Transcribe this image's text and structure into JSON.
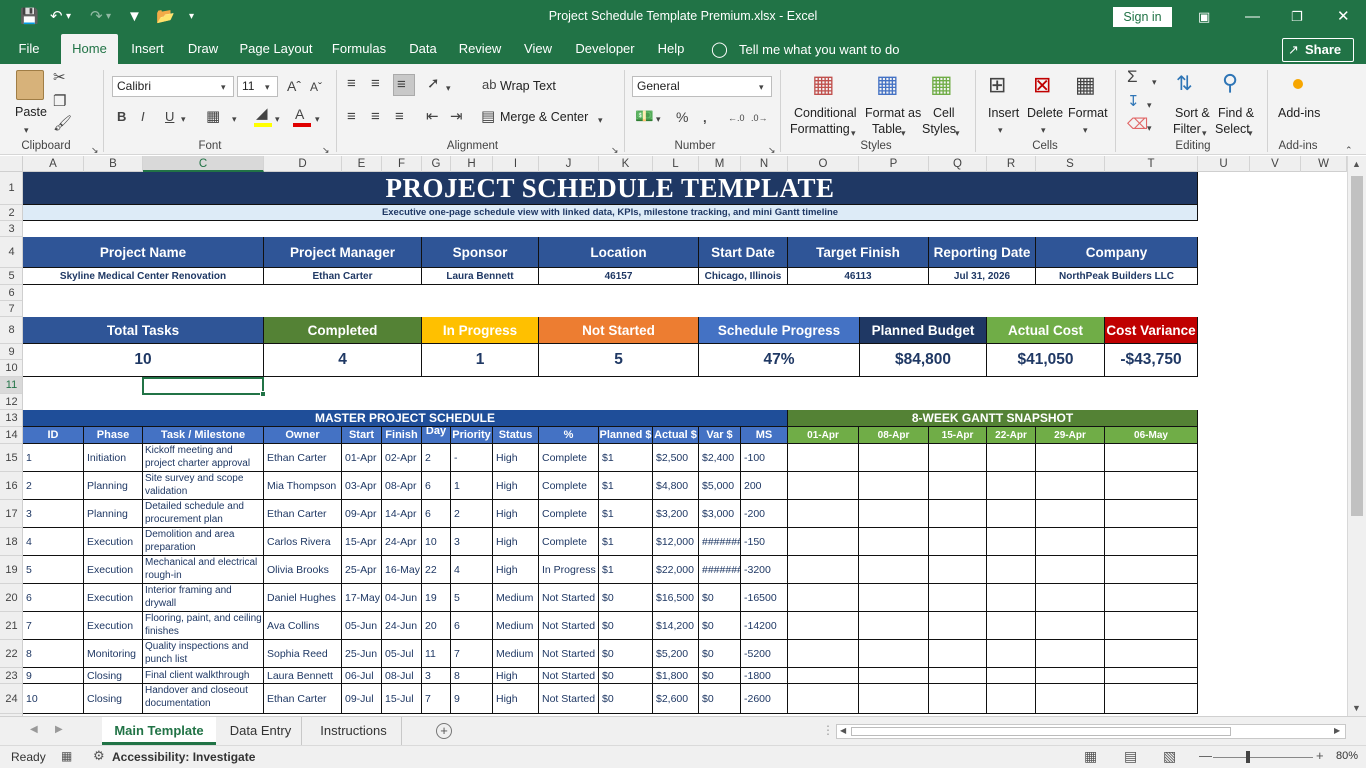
{
  "app": {
    "window_title": "Project Schedule Template Premium.xlsx  -  Excel",
    "sign_in": "Sign in",
    "share": "Share"
  },
  "ribbon_tabs": [
    "File",
    "Home",
    "Insert",
    "Draw",
    "Page Layout",
    "Formulas",
    "Data",
    "Review",
    "View",
    "Developer",
    "Help"
  ],
  "tell_me": "Tell me what you want to do",
  "ribbon": {
    "clipboard": {
      "paste": "Paste",
      "group": "Clipboard"
    },
    "font": {
      "name": "Calibri",
      "size": "11",
      "group": "Font"
    },
    "alignment": {
      "wrap": "Wrap Text",
      "merge": "Merge & Center",
      "group": "Alignment"
    },
    "number": {
      "format": "General",
      "group": "Number"
    },
    "styles": {
      "conditional_1": "Conditional",
      "conditional_2": "Formatting",
      "format_as_1": "Format as",
      "format_as_2": "Table",
      "cell_styles_1": "Cell",
      "cell_styles_2": "Styles",
      "group": "Styles"
    },
    "cells": {
      "insert": "Insert",
      "delete": "Delete",
      "format": "Format",
      "group": "Cells"
    },
    "editing": {
      "sort_1": "Sort &",
      "sort_2": "Filter",
      "find_1": "Find &",
      "find_2": "Select",
      "group": "Editing"
    },
    "addins": {
      "label": "Add-ins",
      "group": "Add-ins"
    }
  },
  "columns": [
    "A",
    "B",
    "C",
    "D",
    "E",
    "F",
    "G",
    "H",
    "I",
    "J",
    "K",
    "L",
    "M",
    "N",
    "O",
    "P",
    "Q",
    "R",
    "S",
    "T",
    "U",
    "V",
    "W"
  ],
  "rows": [
    "1",
    "2",
    "3",
    "4",
    "5",
    "6",
    "7",
    "8",
    "9",
    "10",
    "11",
    "12",
    "13",
    "14",
    "15",
    "16",
    "17",
    "18",
    "19",
    "20",
    "21",
    "22",
    "23",
    "24"
  ],
  "sheet": {
    "title": "PROJECT SCHEDULE TEMPLATE",
    "subtitle": "Executive one-page schedule view with linked data, KPIs, milestone tracking, and mini Gantt timeline",
    "info_headers": [
      "Project Name",
      "Project Manager",
      "Sponsor",
      "Location",
      "Start Date",
      "Target Finish",
      "Reporting Date",
      "Company"
    ],
    "info_values": [
      "Skyline Medical Center Renovation",
      "Ethan Carter",
      "Laura Bennett",
      "46157",
      "Chicago, Illinois",
      "46113",
      "Jul 31, 2026",
      "NorthPeak Builders LLC"
    ],
    "kpi_headers": [
      "Total Tasks",
      "Completed",
      "In Progress",
      "Not Started",
      "Schedule Progress",
      "Planned Budget",
      "Actual Cost",
      "Cost Variance"
    ],
    "kpi_values": [
      "10",
      "4",
      "1",
      "5",
      "47%",
      "$84,800",
      "$41,050",
      "-$43,750"
    ],
    "kpi_colors": [
      "#2f5597",
      "#548235",
      "#ffc000",
      "#ed7d31",
      "#4472c4",
      "#1f3864",
      "#70ad47",
      "#c00000"
    ],
    "master_title": "MASTER PROJECT SCHEDULE",
    "gantt_title": "8-WEEK GANTT SNAPSHOT",
    "task_headers": [
      "ID",
      "Phase",
      "Task / Milestone",
      "Owner",
      "Start",
      "Finish",
      "Day",
      "Priority",
      "Status",
      "%",
      "Planned $",
      "Actual $",
      "Var $",
      "MS"
    ],
    "gantt_weeks": [
      "01-Apr",
      "08-Apr",
      "15-Apr",
      "22-Apr",
      "29-Apr",
      "06-May"
    ],
    "tasks": [
      [
        "1",
        "Initiation",
        "Kickoff meeting and project charter approval",
        "Ethan Carter",
        "01-Apr",
        "02-Apr",
        "2",
        "-",
        "High",
        "Complete",
        "$1",
        "$2,500",
        "$2,400",
        "-100"
      ],
      [
        "2",
        "Planning",
        "Site survey and scope validation",
        "Mia Thompson",
        "03-Apr",
        "08-Apr",
        "6",
        "1",
        "High",
        "Complete",
        "$1",
        "$4,800",
        "$5,000",
        "200"
      ],
      [
        "3",
        "Planning",
        "Detailed schedule and procurement plan",
        "Ethan Carter",
        "09-Apr",
        "14-Apr",
        "6",
        "2",
        "High",
        "Complete",
        "$1",
        "$3,200",
        "$3,000",
        "-200"
      ],
      [
        "4",
        "Execution",
        "Demolition and area preparation",
        "Carlos Rivera",
        "15-Apr",
        "24-Apr",
        "10",
        "3",
        "High",
        "Complete",
        "$1",
        "$12,000",
        "########",
        "-150"
      ],
      [
        "5",
        "Execution",
        "Mechanical and electrical rough-in",
        "Olivia Brooks",
        "25-Apr",
        "16-May",
        "22",
        "4",
        "High",
        "In Progress",
        "$1",
        "$22,000",
        "########",
        "-3200"
      ],
      [
        "6",
        "Execution",
        "Interior framing and drywall",
        "Daniel Hughes",
        "17-May",
        "04-Jun",
        "19",
        "5",
        "Medium",
        "Not Started",
        "$0",
        "$16,500",
        "$0",
        "-16500"
      ],
      [
        "7",
        "Execution",
        "Flooring, paint, and ceiling finishes",
        "Ava Collins",
        "05-Jun",
        "24-Jun",
        "20",
        "6",
        "Medium",
        "Not Started",
        "$0",
        "$14,200",
        "$0",
        "-14200"
      ],
      [
        "8",
        "Monitoring",
        "Quality inspections and punch list",
        "Sophia Reed",
        "25-Jun",
        "05-Jul",
        "11",
        "7",
        "Medium",
        "Not Started",
        "$0",
        "$5,200",
        "$0",
        "-5200"
      ],
      [
        "9",
        "Closing",
        "Final client walkthrough",
        "Laura Bennett",
        "06-Jul",
        "08-Jul",
        "3",
        "8",
        "High",
        "Not Started",
        "$0",
        "$1,800",
        "$0",
        "-1800"
      ],
      [
        "10",
        "Closing",
        "Handover and closeout documentation",
        "Ethan Carter",
        "09-Jul",
        "15-Jul",
        "7",
        "9",
        "High",
        "Not Started",
        "$0",
        "$2,600",
        "$0",
        "-2600"
      ]
    ]
  },
  "sheet_tabs": [
    "Main Template",
    "Data Entry",
    "Instructions"
  ],
  "status": {
    "ready": "Ready",
    "accessibility": "Accessibility: Investigate",
    "zoom": "80%"
  }
}
